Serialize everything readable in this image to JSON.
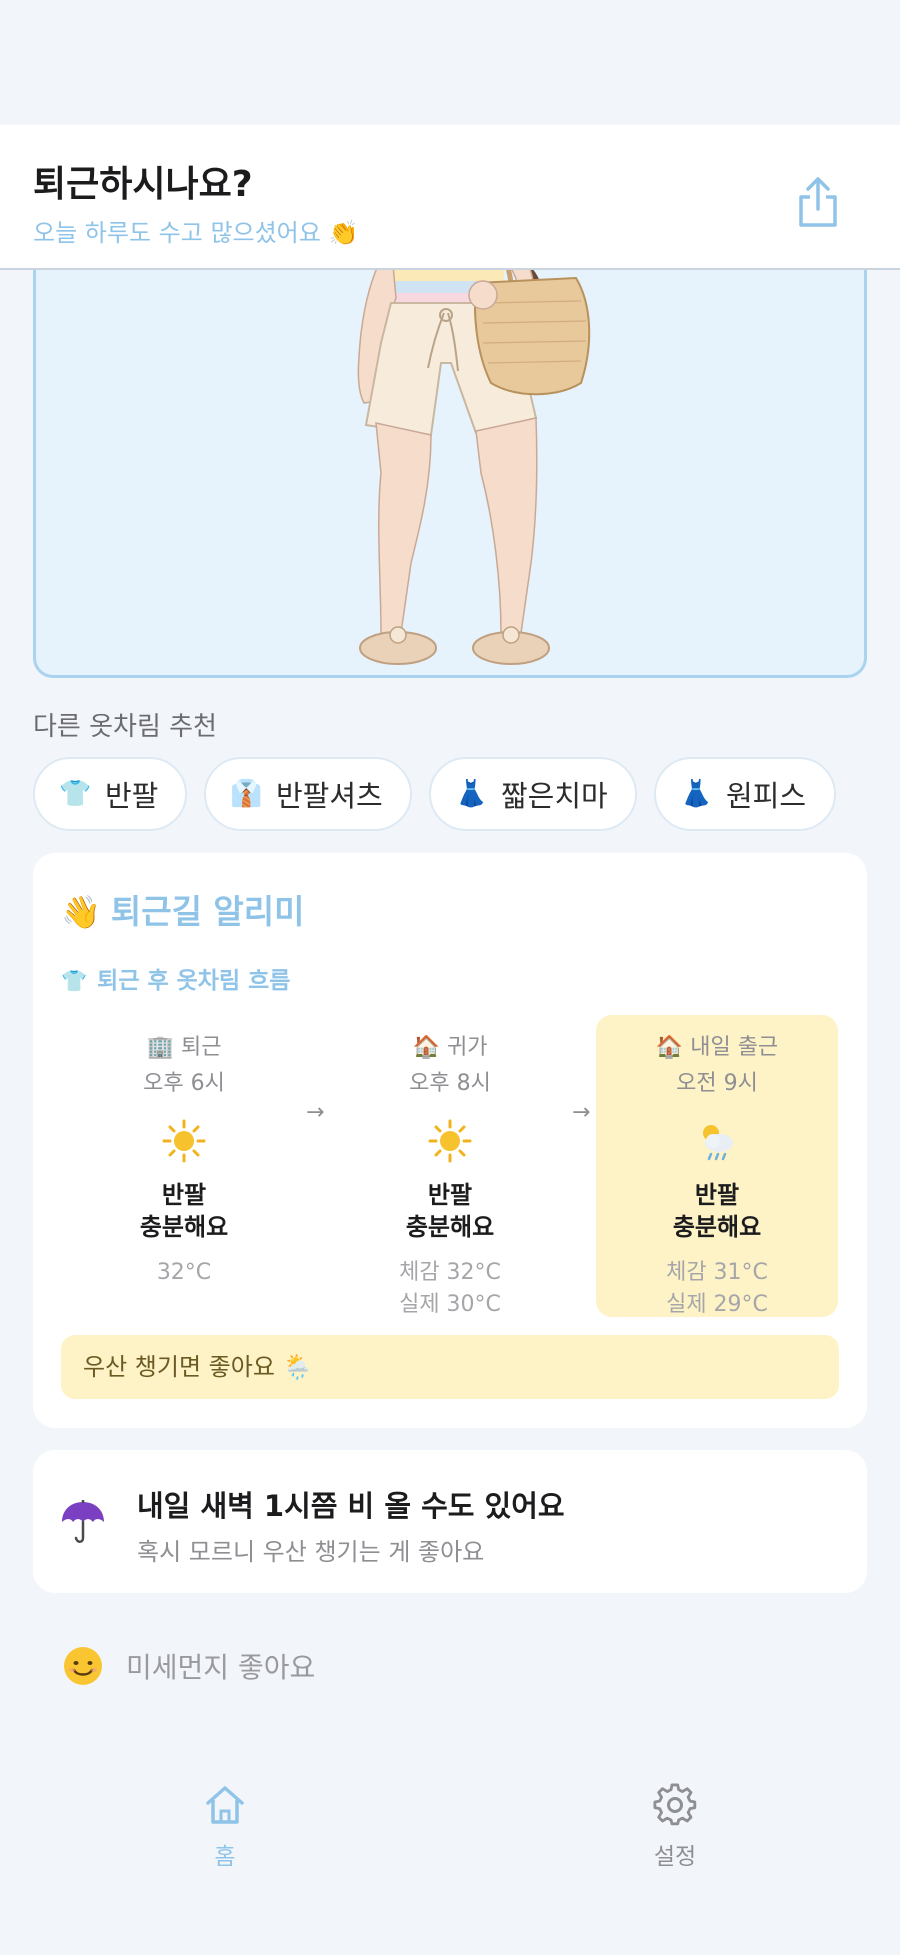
{
  "header": {
    "title": "퇴근하시나요?",
    "subtitle": "오늘 하루도 수고 많으셨어요 👏",
    "share_icon": "share-icon"
  },
  "outfit": {
    "illustration": "outfit-illustration"
  },
  "recommend": {
    "label": "다른 옷차림 추천",
    "chips": [
      {
        "icon": "👕",
        "label": "반팔"
      },
      {
        "icon": "👔",
        "label": "반팔셔츠"
      },
      {
        "icon": "👗",
        "label": "짧은치마"
      },
      {
        "icon": "👗",
        "label": "원피스"
      }
    ]
  },
  "commute": {
    "title_icon": "👋",
    "title": "퇴근길 알리미",
    "flow_icon": "👕",
    "flow_label": "퇴근 후 옷차림 흐름",
    "columns": [
      {
        "head_icon": "🏢",
        "head": "퇴근",
        "time": "오후 6시",
        "weather": "sun-icon",
        "cloth_line1": "반팔",
        "cloth_line2": "충분해요",
        "temp_line1": "32°C",
        "temp_line2": ""
      },
      {
        "head_icon": "🏠",
        "head": "귀가",
        "time": "오후 8시",
        "weather": "sun-icon",
        "cloth_line1": "반팔",
        "cloth_line2": "충분해요",
        "temp_line1": "체감 32°C",
        "temp_line2": "실제 30°C"
      },
      {
        "head_icon": "🏠",
        "head": "내일 출근",
        "time": "오전 9시",
        "weather": "cloud-rain-icon",
        "cloth_line1": "반팔",
        "cloth_line2": "충분해요",
        "temp_line1": "체감 31°C",
        "temp_line2": "실제 29°C"
      }
    ],
    "arrow": "→",
    "umbrella_note": "우산 챙기면 좋아요 🌦️"
  },
  "rain_alert": {
    "icon": "umbrella-icon",
    "title": "내일 새벽 1시쯤 비 올 수도 있어요",
    "subtitle": "혹시 모르니 우산 챙기는 게 좋아요"
  },
  "dust": {
    "icon": "smile-icon",
    "label": "미세먼지 좋아요"
  },
  "tabs": {
    "home": "홈",
    "settings": "설정"
  },
  "colors": {
    "accent": "#8fc4e8",
    "highlight": "#fdf3c6",
    "background": "#f2f6fb"
  }
}
